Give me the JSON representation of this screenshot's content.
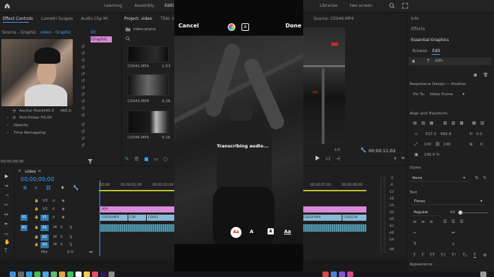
{
  "workspace_tabs": [
    "Learning",
    "Assembly",
    "Editi",
    "Libraries",
    "two screen"
  ],
  "effect_controls": {
    "tabs": [
      "Effect Controls",
      "Lumetri Scopes",
      "Audio Clip Mi"
    ],
    "source": "Source - Graphic",
    "sequence": "video - Graphic",
    "timecode": "00",
    "graphic_label": "Graphic",
    "params": [
      {
        "label": "Anchor Point",
        "v1": "540.0",
        "v2": "960.0"
      },
      {
        "label": "Anti-flicker F...",
        "v1": "0.00",
        "v2": ""
      }
    ],
    "sections": [
      "Opacity",
      "Time Remapping"
    ],
    "bottom_timecode": "00;00;00;00"
  },
  "project": {
    "tabs": [
      "Project: video",
      "Title: (n"
    ],
    "file": "video.prproj",
    "items": [
      {
        "name": "C0041.MP4",
        "dur": "1;53"
      },
      {
        "name": "C0043.MP4",
        "dur": "0;26"
      },
      {
        "name": "C0046.MP4",
        "dur": "0;16"
      }
    ]
  },
  "program": {
    "source_tab": "Source: C0046.MP4",
    "overlay_text": "dfjfs",
    "page": "1/2",
    "timecode": "00;00;11;02"
  },
  "phone": {
    "cancel": "Cancel",
    "done": "Done",
    "status": "Transcribing audio...",
    "style_buttons": [
      "Aa",
      "A",
      "A",
      "Aa"
    ]
  },
  "timeline": {
    "tab": "video",
    "timecode": "00;00;00;00",
    "ruler": [
      ":00;00",
      "00;00;01;00",
      "00;00;02;00",
      "00;00;07;00",
      "00;00;08;00"
    ],
    "tracks": [
      {
        "name": "V3",
        "clip": ""
      },
      {
        "name": "V2",
        "clip": ""
      },
      {
        "name": "V1",
        "clip": ""
      },
      {
        "name": "A1",
        "clip": ""
      },
      {
        "name": "A2",
        "clip": ""
      },
      {
        "name": "A3",
        "clip": ""
      }
    ],
    "mix_label": "Mix",
    "mix_value": "0.0",
    "graphic_clip": "dfjfs",
    "video_clips": [
      "C0029.MP4",
      "C00",
      "C0041",
      "C0029.MP4",
      "C0042.M"
    ],
    "meter_db": [
      "0",
      "-6",
      "-12",
      "-18",
      "-24",
      "-30",
      "-36",
      "-42",
      "-48",
      "-54",
      "-dB"
    ]
  },
  "essential_graphics": {
    "top_tabs": [
      "Info",
      "Effects"
    ],
    "title": "Essential Graphics",
    "tabs": [
      "Browse",
      "Edit"
    ],
    "layer_name": "dfjfs",
    "responsive": "Responsive Design — Position",
    "pin_label": "Pin To:",
    "pin_value": "Video Frame",
    "align_title": "Align and Transform",
    "pos_x": "537.3",
    "pos_y": "992.8",
    "rotation": "0.0",
    "scale": "100",
    "scale2": "100",
    "anchor_val": "0",
    "opacity": "100.0 %",
    "styles_title": "Styles",
    "styles_value": "None",
    "text_title": "Text",
    "font": "Times",
    "weight": "Regular",
    "size": "60",
    "appearance_title": "Appearance"
  },
  "colors": {
    "accent": "#3d9cff",
    "graphic_clip": "#d98bd9",
    "video_clip": "#8ab8d8",
    "audio_clip": "#3e7a8e"
  }
}
